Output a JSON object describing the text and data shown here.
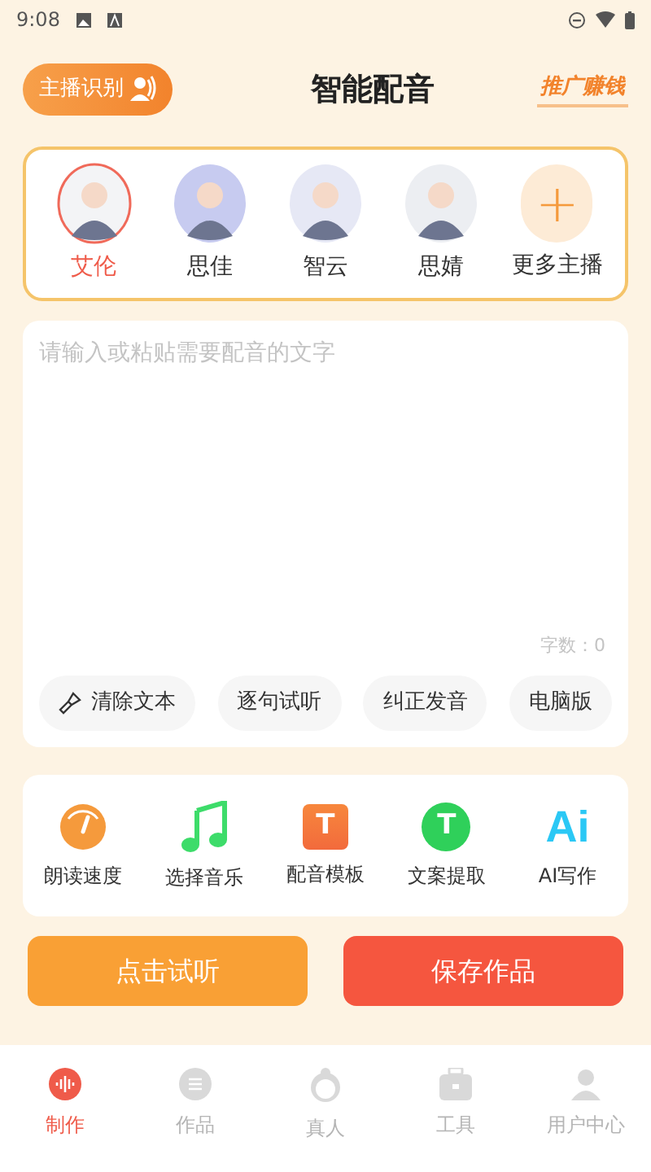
{
  "status_bar": {
    "time": "9:08"
  },
  "header": {
    "left_button": "主播识别",
    "title": "智能配音",
    "promo": "推广赚钱"
  },
  "speakers": [
    {
      "name": "艾伦",
      "selected": true,
      "kind": "avatar",
      "color": "#f3f4f6"
    },
    {
      "name": "思佳",
      "selected": false,
      "kind": "avatar",
      "color": "#c7cbf0"
    },
    {
      "name": "智云",
      "selected": false,
      "kind": "avatar",
      "color": "#e6e8f5"
    },
    {
      "name": "思婧",
      "selected": false,
      "kind": "avatar",
      "color": "#eceef2"
    },
    {
      "name": "更多主播",
      "selected": false,
      "kind": "more",
      "icon": "+"
    }
  ],
  "editor": {
    "placeholder": "请输入或粘贴需要配音的文字",
    "count": "字数：0",
    "actions": [
      {
        "label": "清除文本",
        "kind": "clear"
      },
      {
        "label": "逐句试听",
        "kind": "plain"
      },
      {
        "label": "纠正发音",
        "kind": "plain"
      },
      {
        "label": "电脑版",
        "kind": "plain"
      }
    ]
  },
  "tools": [
    {
      "label": "朗读速度",
      "kind": "speed"
    },
    {
      "label": "选择音乐",
      "kind": "music"
    },
    {
      "label": "配音模板",
      "kind": "template",
      "icon": "T"
    },
    {
      "label": "文案提取",
      "kind": "extract",
      "icon": "T"
    },
    {
      "label": "AI写作",
      "kind": "ai",
      "icon": "Ai"
    }
  ],
  "buttons": [
    {
      "label": "点击试听",
      "kind": "listen"
    },
    {
      "label": "保存作品",
      "kind": "save"
    }
  ],
  "bottom_nav": [
    {
      "label": "制作",
      "selected": true,
      "kind": "make"
    },
    {
      "label": "作品",
      "selected": false,
      "kind": "works"
    },
    {
      "label": "真人",
      "selected": false,
      "kind": "person"
    },
    {
      "label": "工具",
      "selected": false,
      "kind": "tools"
    },
    {
      "label": "用户中心",
      "selected": false,
      "kind": "user"
    }
  ]
}
